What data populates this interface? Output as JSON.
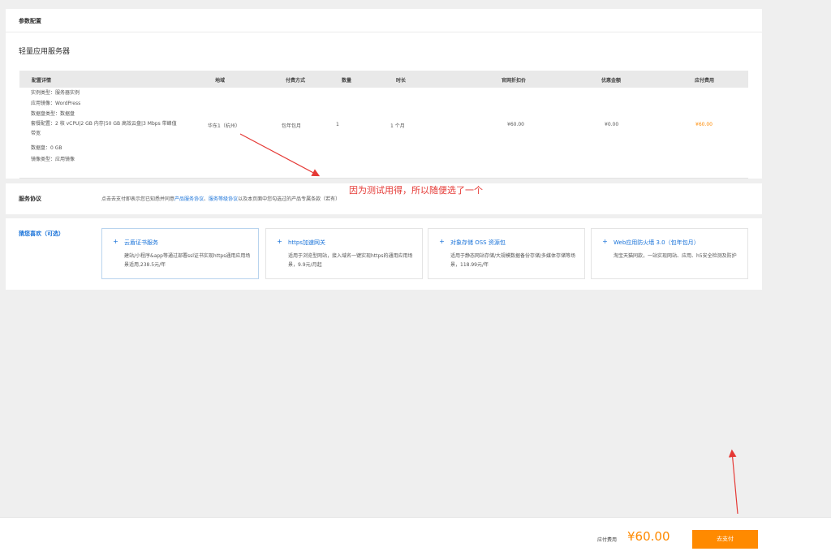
{
  "config": {
    "section_title": "参数配置",
    "product_name": "轻量应用服务器",
    "columns": {
      "details": "配置详情",
      "region": "地域",
      "payment": "付费方式",
      "quantity": "数量",
      "duration": "时长",
      "list_price": "官网折扣价",
      "discount": "优惠金额",
      "due": "应付费用"
    },
    "row": {
      "instance_type": "实例类型：服务器实例",
      "image": "应用镜像：WordPress",
      "disk_type": "数据盘类型：数据盘",
      "package": "套餐配置：2 核 vCPU|2 GB 内存|50 GB 高效云盘|3 Mbps 带峰值带宽",
      "data_disk": "数据盘：0 GB",
      "image_type": "镜像类型：应用镜像",
      "region": "华东1（杭州）",
      "payment": "包年包月",
      "quantity": "1",
      "duration": "1 个月",
      "list_price": "¥60.00",
      "discount": "¥0.00",
      "due": "¥60.00"
    }
  },
  "agreement": {
    "label": "服务协议",
    "text_before": "点击去支付即表示您已知悉并同意",
    "link1": "产品服务协议",
    "sep": "、",
    "link2": "服务等级协议",
    "text_after": "以及本页面中您勾选过的产品专属条款（若有）"
  },
  "recommend": {
    "label": "猜您喜欢（可选）",
    "items": [
      {
        "title": "云盾证书服务",
        "desc": "建站/小程序&app等通过部署ssl证书实现https通用应用场景适用,238.5元/年"
      },
      {
        "title": "https加速网关",
        "desc": "适用于浏览型网站，接入域名一键实现https的通用应用场景，9.9元/月起"
      },
      {
        "title": "对象存储 OSS 资源包",
        "desc": "适用于静态网站存储/大规模数据备份存储/多媒体存储等场景，118.99元/年"
      },
      {
        "title": "Web应用防火墙 3.0（包年包月）",
        "desc": "淘宝天猫同款，一站实现网站、应用、h5安全检测及防护"
      }
    ]
  },
  "annotation": "因为测试用得，所以随便选了一个",
  "footer": {
    "label": "应付费用",
    "price": "¥60.00",
    "pay_button": "去支付"
  },
  "colors": {
    "accent": "#ff8a00",
    "link": "#1a73d9",
    "annotation": "#e53935"
  }
}
